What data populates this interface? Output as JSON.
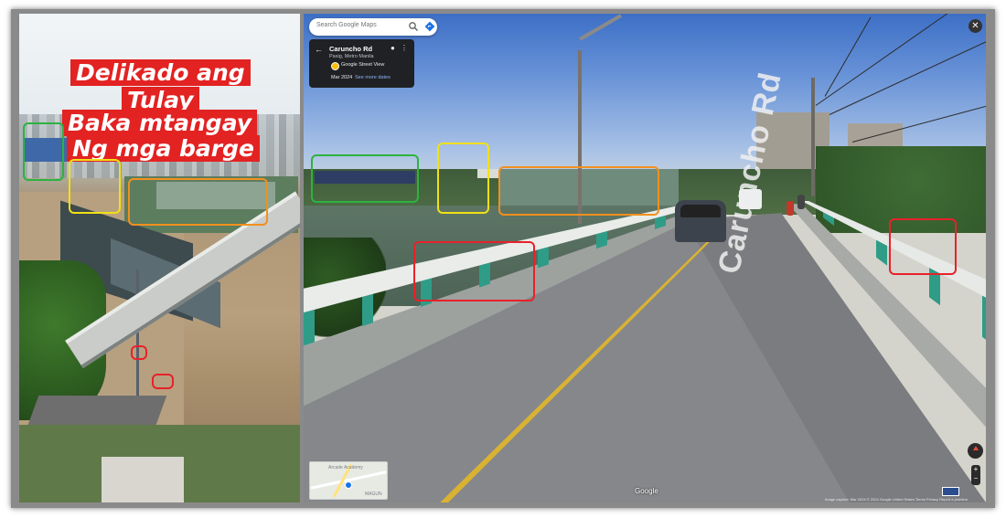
{
  "caption": {
    "line1": "Delikado ang",
    "line2": "Tulay",
    "line3": "Baka mtangay",
    "line4": "Ng mga barge"
  },
  "maps": {
    "search_placeholder": "Search Google Maps",
    "place_title": "Caruncho Rd",
    "place_subtitle": "Pasig, Metro Manila",
    "street_view_label": "Google Street View",
    "capture_date": "Mar 2024",
    "see_more_dates": "See more dates",
    "road_marking": "Caruncho Rd",
    "watermark": "Google",
    "credits": "Image capture: Mar 2024   © 2024 Google   United States   Terms   Privacy   Report a problem",
    "minimap_label_1": "Arcade Academy",
    "minimap_label_2": "MAGUN"
  },
  "icons": {
    "back": "arrow-left",
    "search": "magnifier",
    "directions": "directions-diamond",
    "pin": "map-pin",
    "more": "vertical-dots",
    "close": "x-circle",
    "compass": "compass",
    "zoom": "plus-minus",
    "layers": "layers"
  },
  "colors": {
    "caption_bg": "#e32222",
    "box_green": "#2cb33f",
    "box_yellow": "#f1e016",
    "box_orange": "#f2901e",
    "box_red": "#e8212a",
    "card_bg": "#202124",
    "link_blue": "#8ab4f8"
  }
}
